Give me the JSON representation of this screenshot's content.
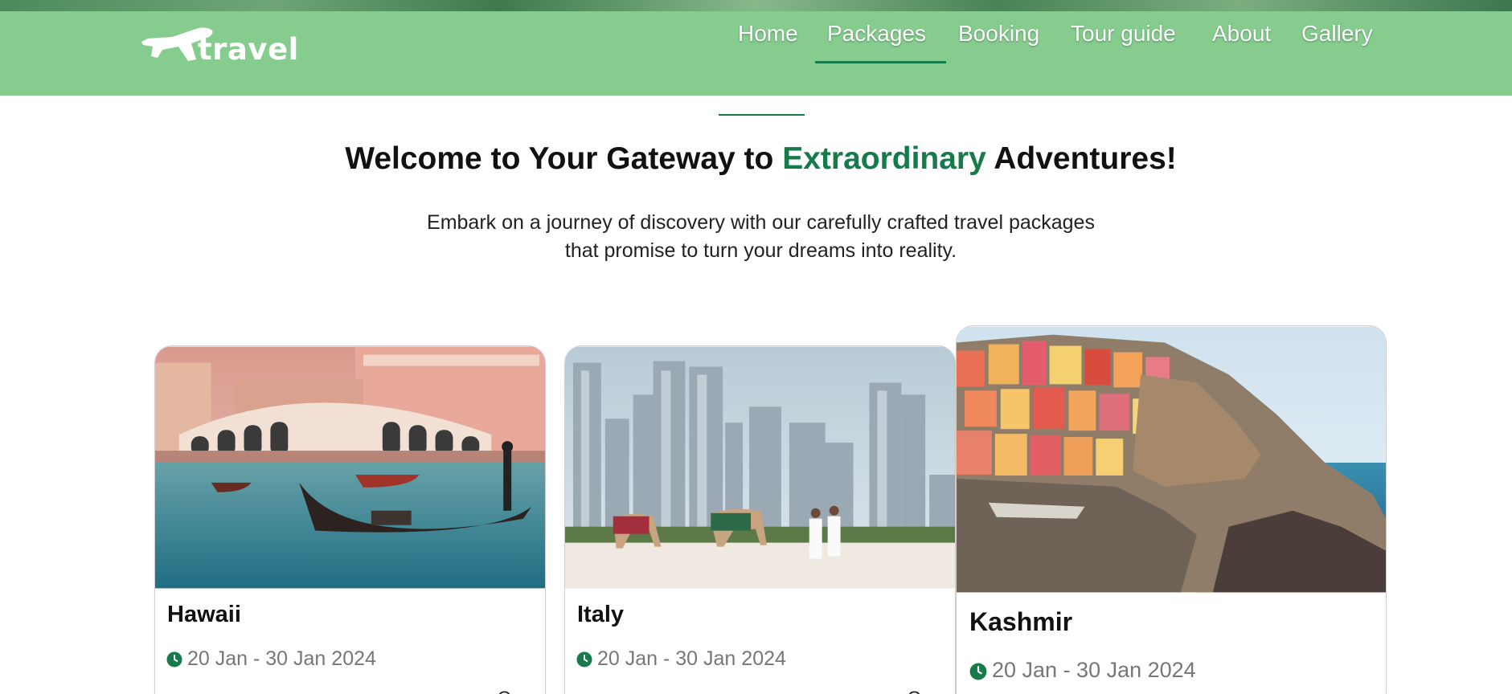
{
  "brand": {
    "logo_text": "travel"
  },
  "nav": {
    "items": [
      "Home",
      "Packages",
      "Booking",
      "Tour guide",
      "About",
      "Gallery"
    ],
    "active": "Packages"
  },
  "intro": {
    "headline_before": "Welcome to Your Gateway to ",
    "headline_accent": "Extraordinary",
    "headline_after": " Adventures!",
    "subtext": "Embark on a journey of discovery with our carefully crafted travel packages that promise to turn your dreams into reality."
  },
  "cards": [
    {
      "title": "Hawaii",
      "date": "20 Jan - 30 Jan 2024",
      "cut_text": "O.."
    },
    {
      "title": "Italy",
      "date": "20 Jan - 30 Jan 2024",
      "cut_text": "O.."
    },
    {
      "title": "Kashmir",
      "date": "20 Jan - 30 Jan 2024"
    }
  ],
  "colors": {
    "header_bg": "#85cc8e",
    "accent": "#167a4a",
    "text": "#111111",
    "muted": "#777777"
  }
}
